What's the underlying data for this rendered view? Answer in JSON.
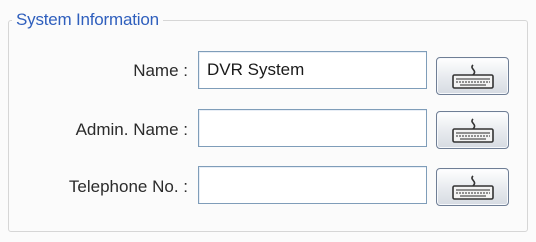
{
  "system_information": {
    "title": "System Information",
    "fields": [
      {
        "label": "Name :",
        "value": "DVR System",
        "keyboard_icon": "keyboard-icon"
      },
      {
        "label": "Admin. Name :",
        "value": "",
        "keyboard_icon": "keyboard-icon"
      },
      {
        "label": "Telephone No. :",
        "value": "",
        "keyboard_icon": "keyboard-icon"
      }
    ]
  },
  "colors": {
    "group_title": "#2f5fbd",
    "field_border": "#7f9db9",
    "button_border": "#6f7e95"
  }
}
